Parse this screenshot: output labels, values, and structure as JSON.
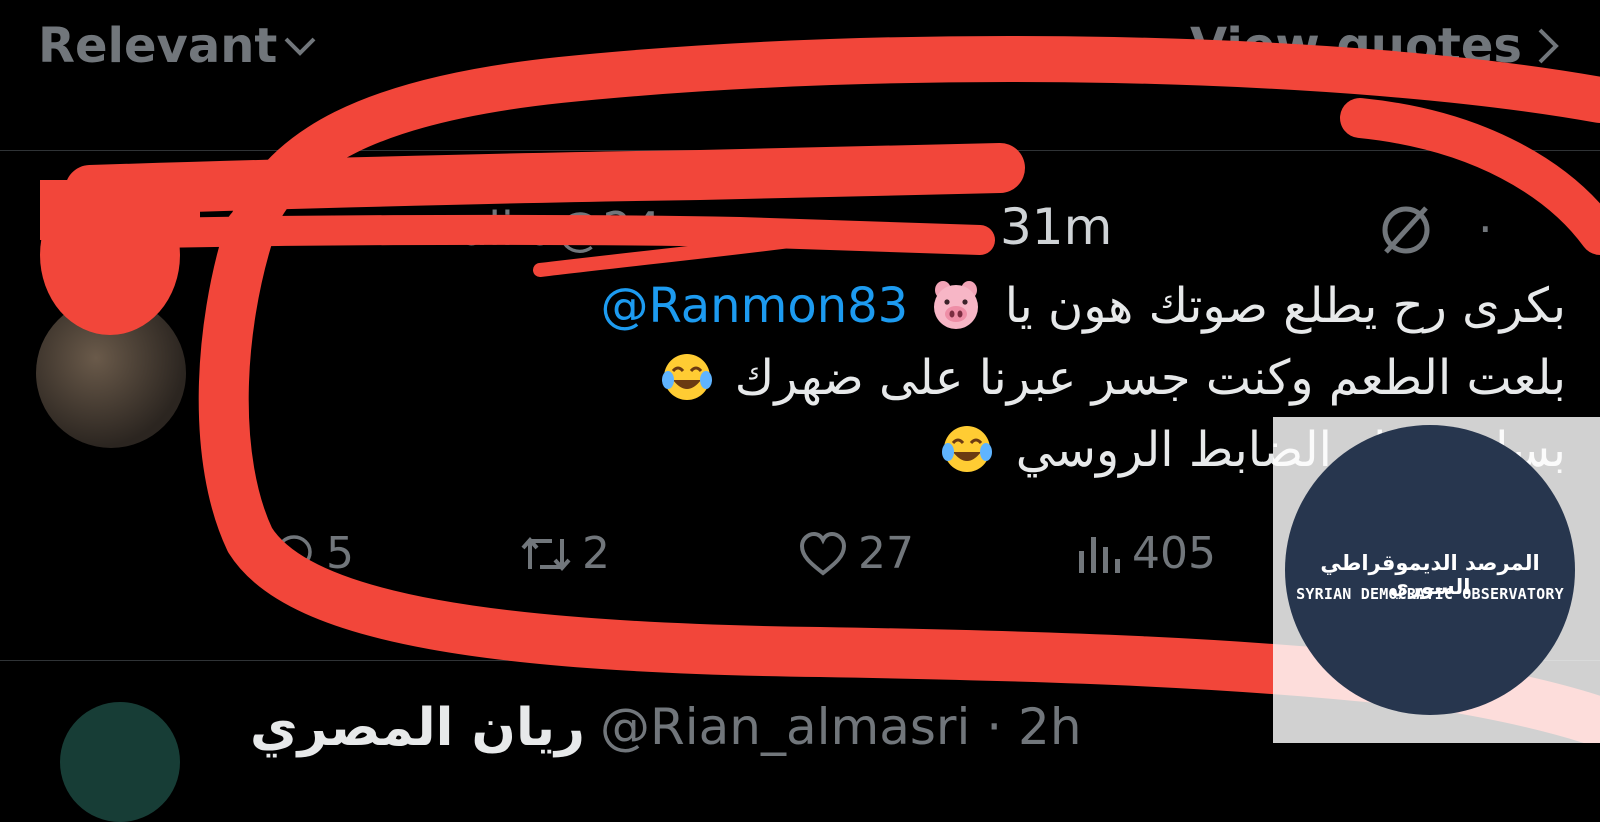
{
  "header": {
    "sort_label": "Relevant",
    "view_quotes_label": "View quotes"
  },
  "tweet": {
    "author_partial": "ali a@24",
    "time": "31m",
    "mention": "@Ranmon83",
    "line1_text": "بكرى رح يطلع صوتك هون يا",
    "line2_text": "بلعت الطعم وكنت جسر عبرنا على ضهرك",
    "line3_text": "بسلم عليك الضابط الروسي",
    "actions": {
      "replies": "5",
      "reposts": "2",
      "likes": "27",
      "views": "405"
    }
  },
  "next_reply": {
    "name": "ريان المصري",
    "handle": "@Rian_almasri · 2h"
  },
  "watermark": {
    "arabic": "المرصد الديموقراطي السوري",
    "english": "SYRIAN DEMOCRATIC OBSERVATORY"
  },
  "colors": {
    "background": "#000000",
    "text": "#e7e9ea",
    "muted": "#71767b",
    "link": "#1d9bf0",
    "redaction": "#f2463a"
  },
  "icons": [
    "chevron-down-icon",
    "chevron-right-icon",
    "grok-icon",
    "more-icon",
    "pig-face-emoji",
    "laughing-tears-emoji",
    "reply-icon",
    "repost-icon",
    "like-icon",
    "views-icon"
  ]
}
